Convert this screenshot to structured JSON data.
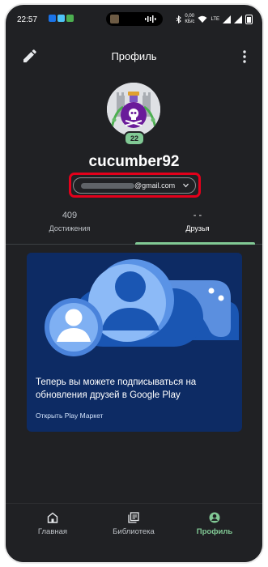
{
  "status_bar": {
    "time": "22:57",
    "network_speed": "0,00",
    "network_unit": "КБ/с",
    "network_type": "LTE"
  },
  "header": {
    "title": "Профиль",
    "edit_icon": "pencil-icon",
    "more_icon": "more-vert-icon"
  },
  "profile": {
    "username": "cucumber92",
    "level": "22",
    "email_domain": "@gmail.com"
  },
  "tabs": [
    {
      "count": "409",
      "label": "Достижения",
      "active": false
    },
    {
      "count": "- -",
      "label": "Друзья",
      "active": true
    }
  ],
  "promo_card": {
    "title": "Теперь вы можете подписываться на обновления друзей в Google Play",
    "link": "Открыть Play Маркет"
  },
  "bottom_nav": [
    {
      "label": "Главная",
      "icon": "home-icon",
      "active": false
    },
    {
      "label": "Библиотека",
      "icon": "library-icon",
      "active": false
    },
    {
      "label": "Профиль",
      "icon": "profile-icon",
      "active": true
    }
  ],
  "colors": {
    "background": "#202124",
    "accent": "#81c995",
    "card": "#0d2b64",
    "highlight": "#e3001b"
  }
}
